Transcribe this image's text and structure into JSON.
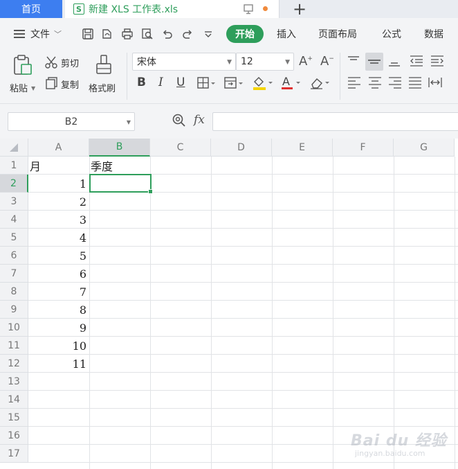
{
  "tabs": {
    "home": "首页",
    "document": "新建 XLS 工作表.xls",
    "document_icon_letter": "S",
    "new_tab": "+"
  },
  "menu": {
    "file": "文件",
    "items": [
      "开始",
      "插入",
      "页面布局",
      "公式",
      "数据"
    ]
  },
  "ribbon": {
    "paste": "粘贴",
    "cut": "剪切",
    "copy": "复制",
    "format_painter": "格式刷",
    "font_name": "宋体",
    "font_size": "12"
  },
  "formula_bar": {
    "name_box": "B2",
    "fx": "fx",
    "formula": ""
  },
  "sheet": {
    "columns": [
      "A",
      "B",
      "C",
      "D",
      "E",
      "F",
      "G"
    ],
    "rows": [
      "1",
      "2",
      "3",
      "4",
      "5",
      "6",
      "7",
      "8",
      "9",
      "10",
      "11",
      "12",
      "13",
      "14",
      "15",
      "16",
      "17"
    ],
    "active_cell": "B2",
    "cells": {
      "A1": "月",
      "B1": "季度",
      "A2": "1",
      "A3": "2",
      "A4": "3",
      "A5": "4",
      "A6": "5",
      "A7": "6",
      "A8": "7",
      "A9": "8",
      "A10": "9",
      "A11": "10",
      "A12": "11"
    }
  },
  "watermark": {
    "main": "Bai du 经验",
    "sub": "jingyan.baidu.com"
  },
  "colors": {
    "accent_green": "#2e9e5b",
    "home_tab_blue": "#3d7ef0"
  }
}
